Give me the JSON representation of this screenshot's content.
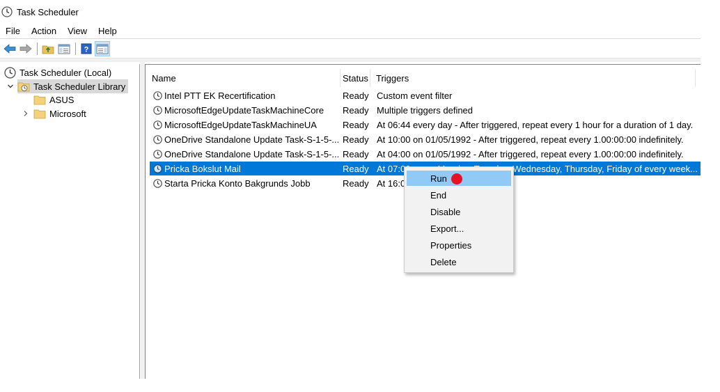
{
  "window": {
    "title": "Task Scheduler",
    "icon": "clock-icon"
  },
  "menubar": {
    "items": [
      "File",
      "Action",
      "View",
      "Help"
    ]
  },
  "toolbar": {
    "buttons": [
      "back-icon",
      "forward-icon",
      "up-folder-icon",
      "show-hide-console-tree-icon",
      "help-icon",
      "show-hide-action-pane-icon"
    ]
  },
  "tree": {
    "items": [
      {
        "label": "Task Scheduler (Local)",
        "icon": "clock-icon"
      },
      {
        "label": "Task Scheduler Library",
        "icon": "folder-clock-icon",
        "expanded": true,
        "selected": true
      },
      {
        "label": "ASUS",
        "icon": "folder-icon"
      },
      {
        "label": "Microsoft",
        "icon": "folder-icon",
        "expandable": true
      }
    ]
  },
  "list": {
    "columns": [
      "Name",
      "Status",
      "Triggers"
    ],
    "rows": [
      {
        "name": "Intel PTT EK Recertification",
        "status": "Ready",
        "triggers": "Custom event filter"
      },
      {
        "name": "MicrosoftEdgeUpdateTaskMachineCore",
        "status": "Ready",
        "triggers": "Multiple triggers defined"
      },
      {
        "name": "MicrosoftEdgeUpdateTaskMachineUA",
        "status": "Ready",
        "triggers": "At 06:44 every day - After triggered, repeat every 1 hour for a duration of 1 day."
      },
      {
        "name": "OneDrive Standalone Update Task-S-1-5-...",
        "status": "Ready",
        "triggers": "At 10:00 on 01/05/1992 - After triggered, repeat every 1.00:00:00 indefinitely."
      },
      {
        "name": "OneDrive Standalone Update Task-S-1-5-...",
        "status": "Ready",
        "triggers": "At 04:00 on 01/05/1992 - After triggered, repeat every 1.00:00:00 indefinitely."
      },
      {
        "name": "Pricka Bokslut Mail",
        "status": "Ready",
        "triggers": "At 07:00 every Monday, Tuesday, Wednesday, Thursday, Friday of every week...",
        "selected": true
      },
      {
        "name": "Starta Pricka Konto Bakgrunds Jobb",
        "status": "Ready",
        "triggers": "At 16:00"
      }
    ]
  },
  "context_menu": {
    "items": [
      "Run",
      "End",
      "Disable",
      "Export...",
      "Properties",
      "Delete"
    ],
    "highlighted": "Run",
    "marker_color": "#e81123"
  },
  "colors": {
    "selection": "#0078d7",
    "menu_hover": "#91c9f7",
    "tree_selected": "#d9d9d9"
  }
}
